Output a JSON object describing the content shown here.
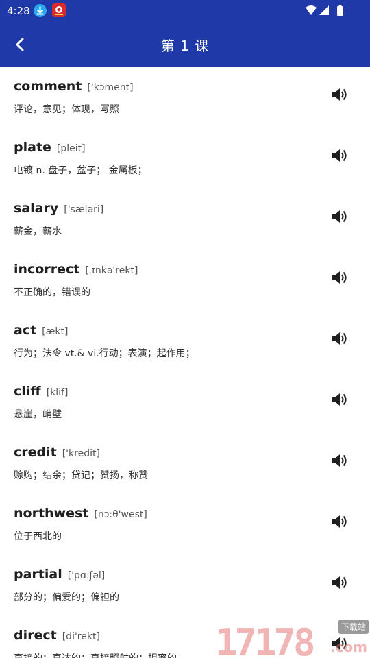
{
  "status_bar": {
    "time": "4:28"
  },
  "header": {
    "title": "第 1 课"
  },
  "words": [
    {
      "word": "comment",
      "phonetic": "['kɔment]",
      "meaning": "评论，意见；体现，写照"
    },
    {
      "word": "plate",
      "phonetic": "[pleit]",
      "meaning": "电镀  n. 盘子，盆子；  金属板；"
    },
    {
      "word": "salary",
      "phonetic": "['sæləri]",
      "meaning": "薪金，薪水"
    },
    {
      "word": "incorrect",
      "phonetic": "[ˌɪnkə'rekt]",
      "meaning": "不正确的，错误的"
    },
    {
      "word": "act",
      "phonetic": "[ækt]",
      "meaning": "行为；法令   vt.& vi.行动；表演；起作用；"
    },
    {
      "word": "cliff",
      "phonetic": "[klif]",
      "meaning": "悬崖，峭壁"
    },
    {
      "word": "credit",
      "phonetic": "['kredit]",
      "meaning": "赊购；结余；贷记；赞扬，称赞"
    },
    {
      "word": "northwest",
      "phonetic": "[nɔ:θ'west]",
      "meaning": "位于西北的"
    },
    {
      "word": "partial",
      "phonetic": "['pɑ:ʃəl]",
      "meaning": "部分的；偏爱的；偏袒的"
    },
    {
      "word": "direct",
      "phonetic": "[di'rekt]",
      "meaning": "直接的；直达的；直接照射的；坦率的"
    }
  ],
  "watermark": {
    "text": "17178",
    "badge": "下载站",
    "suffix": ".com"
  },
  "colors": {
    "header": "#1f3aa8",
    "text": "#1f1f1f"
  }
}
